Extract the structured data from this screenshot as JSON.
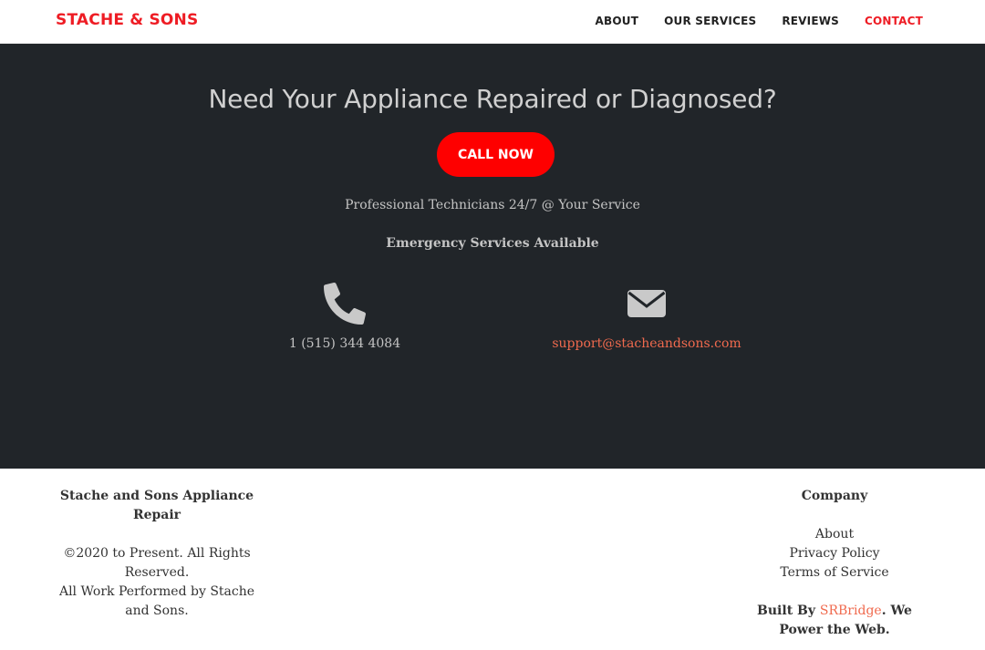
{
  "nav": {
    "brand": "STACHE & SONS",
    "links": [
      {
        "label": "ABOUT"
      },
      {
        "label": "OUR SERVICES"
      },
      {
        "label": "REVIEWS"
      },
      {
        "label": "CONTACT",
        "active": true
      }
    ]
  },
  "hero": {
    "title": "Need Your Appliance Repaired or Diagnosed?",
    "call_button": "CALL NOW",
    "tagline": "Professional Technicians 24/7 @ Your Service",
    "emergency": "Emergency Services Available",
    "phone": "1 (515) 344 4084",
    "email": "support@stacheandsons.com"
  },
  "footer": {
    "company_name": "Stache and Sons Appliance Repair",
    "copyright": "©2020 to Present. All Rights Reserved.",
    "work_by": "All Work Performed by Stache and Sons.",
    "company_heading": "Company",
    "links": [
      {
        "label": "About"
      },
      {
        "label": "Privacy Policy"
      },
      {
        "label": "Terms of Service"
      }
    ],
    "built_by_prefix": "Built By ",
    "built_by_link": "SRBridge",
    "built_by_suffix": ". We Power the Web."
  },
  "colors": {
    "brand_red": "#ee1c24",
    "button_red": "#fe0000",
    "link_orange": "#f06a4e",
    "hero_bg": "#212529"
  },
  "icons": {
    "phone": "phone-icon",
    "email": "envelope-icon"
  }
}
